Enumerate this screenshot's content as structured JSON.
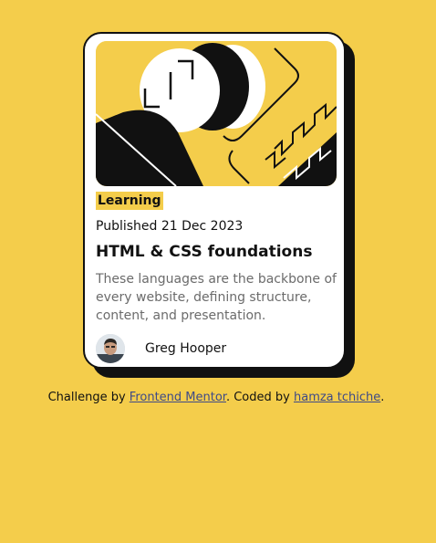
{
  "card": {
    "tag": "Learning",
    "published": "Published 21 Dec 2023",
    "title": "HTML & CSS foundations",
    "description": "These languages are the backbone of every website, defining structure, content, and presentation.",
    "author": "Greg Hooper",
    "illustration_icon": "abstract-illustration",
    "avatar_icon": "avatar-photo"
  },
  "attribution": {
    "prefix": "Challenge by ",
    "link1": "Frontend Mentor",
    "middle": ". Coded by ",
    "link2": "hamza tchiche",
    "suffix": "."
  },
  "colors": {
    "background": "#f4cd4b",
    "text": "#111111",
    "muted": "#6b6b6b",
    "link": "#3e4a87"
  }
}
